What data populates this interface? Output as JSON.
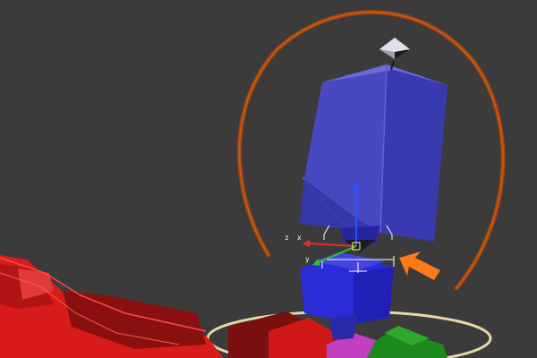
{
  "viewport": {
    "background": "#3b3b3b",
    "axis_labels": {
      "x": "x",
      "y": "y",
      "z": "z"
    }
  },
  "colors": {
    "blue_body": "#3535d8",
    "blue_top": "#4a4ac8",
    "blue_side": "#2b2bb0",
    "red_limb": "#d81c1c",
    "dark_red": "#7a1010",
    "green": "#1c8a1c",
    "magenta": "#c040c0",
    "ring_orange": "#a0440c",
    "ring_cream": "#e8d8a8",
    "arrow_orange": "#ff7a1a",
    "gizmo_x": "#e03030",
    "gizmo_y": "#30c030",
    "gizmo_z": "#3050ff",
    "selection": "#ffffff"
  },
  "icons": {
    "pointer": "orange-arrow-icon",
    "gizmo": "transform-gizmo-icon",
    "top_marker": "pyramid-marker-icon"
  }
}
